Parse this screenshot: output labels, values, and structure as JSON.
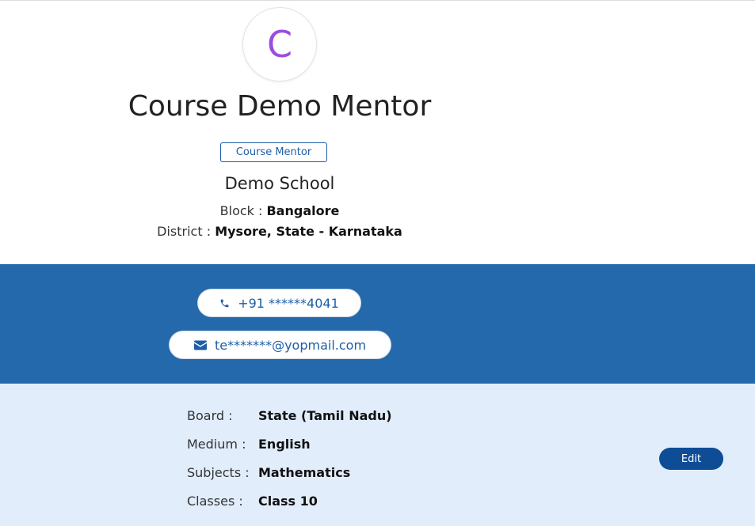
{
  "profile": {
    "avatar_letter": "C",
    "name": "Course Demo Mentor",
    "role": "Course Mentor",
    "school": "Demo School",
    "block_label": "Block :",
    "block_value": "Bangalore",
    "district_label": "District :",
    "district_value": "Mysore, State - Karnataka"
  },
  "contact": {
    "phone": "+91 ******4041",
    "email": "te*******@yopmail.com",
    "phone_icon": "phone-icon",
    "email_icon": "envelope-icon"
  },
  "details": {
    "rows": [
      {
        "label": "Board :",
        "value": "State (Tamil Nadu)"
      },
      {
        "label": "Medium :",
        "value": "English"
      },
      {
        "label": "Subjects :",
        "value": "Mathematics"
      },
      {
        "label": "Classes :",
        "value": "Class 10"
      }
    ],
    "edit_label": "Edit"
  },
  "colors": {
    "accent": "#2369ab",
    "avatar_letter": "#9b4de0",
    "details_bg": "#e1edfb",
    "button": "#0e4d96"
  }
}
